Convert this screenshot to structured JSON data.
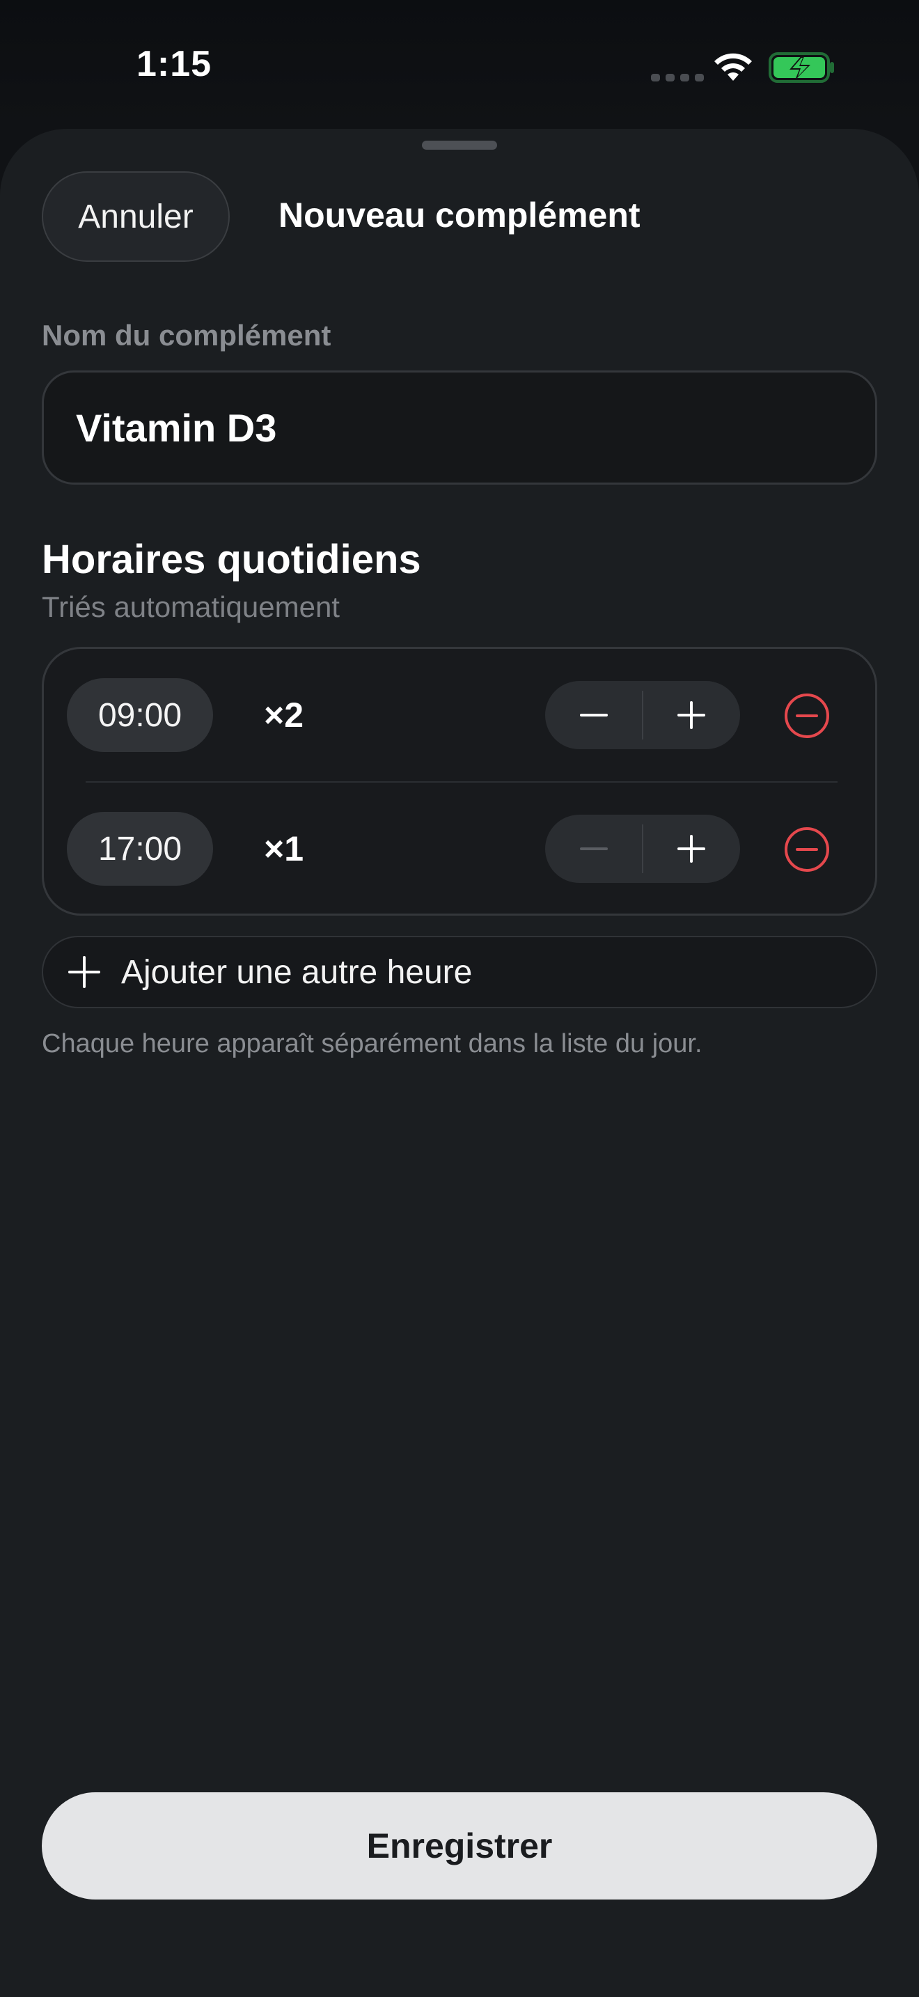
{
  "status_bar": {
    "time": "1:15",
    "icons": [
      "cellular-icon",
      "wifi-icon",
      "battery-charging-icon"
    ],
    "battery_color": "#34c759"
  },
  "sheet": {
    "cancel_label": "Annuler",
    "title": "Nouveau complément"
  },
  "name_field": {
    "label": "Nom du complément",
    "value": "Vitamin D3"
  },
  "schedule": {
    "title": "Horaires quotidiens",
    "subtitle": "Triés automatiquement",
    "rows": [
      {
        "time": "09:00",
        "count": "×2",
        "decrement_enabled": true
      },
      {
        "time": "17:00",
        "count": "×1",
        "decrement_enabled": false
      }
    ],
    "add_label": "Ajouter une autre heure",
    "hint": "Chaque heure apparaît séparément dans la liste du jour."
  },
  "save_label": "Enregistrer",
  "colors": {
    "background": "#1b1e21",
    "remove_red": "#e5484d",
    "save_button": "#e4e5e7"
  }
}
